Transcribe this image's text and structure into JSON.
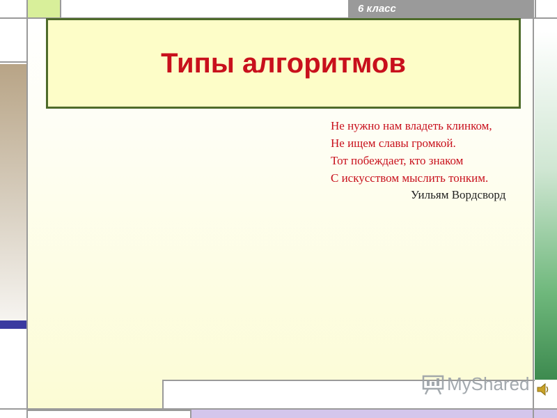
{
  "header": {
    "grade_label": "6 класс"
  },
  "slide": {
    "title": "Типы алгоритмов"
  },
  "poem": {
    "lines": [
      "Не нужно нам владеть клинком,",
      "Не ищем славы громкой.",
      "Тот побеждает, кто знаком",
      "С искусством мыслить тонким."
    ],
    "author": "Уильям Вордсворд"
  },
  "watermark": {
    "text": "MyShared",
    "icon": "presentation-board-icon"
  },
  "audio": {
    "icon": "speaker-icon"
  },
  "colors": {
    "title_red": "#c8101c",
    "title_box_bg": "#fdfdc8",
    "title_border": "#4e6b2a",
    "top_bar_gray": "#9a9a9a",
    "accent_green": "#3d8a4f",
    "accent_blue": "#3a3aa0",
    "lavender": "#d4c6ec"
  }
}
